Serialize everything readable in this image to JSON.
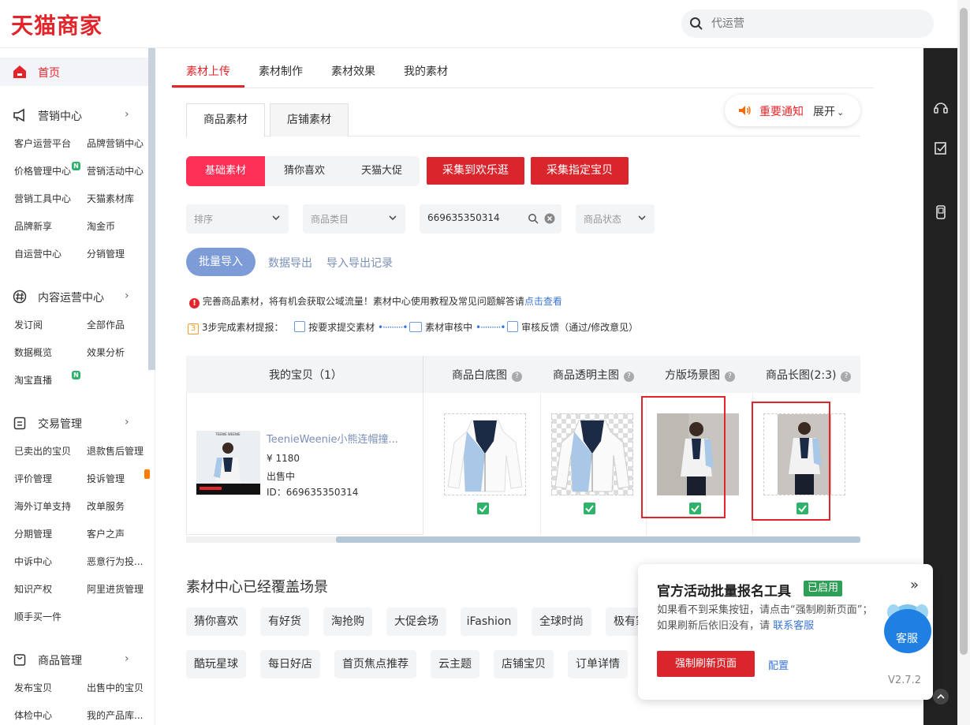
{
  "header": {
    "logo": "天猫商家",
    "search_placeholder": "代运营"
  },
  "sidebar": {
    "home": "首页",
    "sections": [
      {
        "title": "营销中心",
        "items": [
          "客户运营平台",
          "品牌营销中心",
          "价格管理中心",
          "营销活动中心",
          "营销工具中心",
          "天猫素材库",
          "品牌新享",
          "淘金币",
          "自运营中心",
          "分销管理"
        ]
      },
      {
        "title": "内容运营中心",
        "items": [
          "发订阅",
          "全部作品",
          "数据概览",
          "效果分析",
          "淘宝直播"
        ]
      },
      {
        "title": "交易管理",
        "items": [
          "已卖出的宝贝",
          "退款售后管理",
          "评价管理",
          "投诉管理",
          "海外订单支持",
          "改单服务",
          "分期管理",
          "客户之声",
          "中诉中心",
          "恶意行为投...",
          "知识产权",
          "阿里进货管理",
          "顺手买一件"
        ]
      },
      {
        "title": "商品管理",
        "items": [
          "发布宝贝",
          "出售中的宝贝",
          "体检中心",
          "我的产品库..."
        ]
      }
    ],
    "badge_n": "N"
  },
  "main": {
    "top_tabs": [
      "素材上传",
      "素材制作",
      "素材效果",
      "我的素材"
    ],
    "sub_tabs": [
      "商品素材",
      "店铺素材"
    ],
    "notice": {
      "label": "重要通知",
      "expand": "展开"
    },
    "segments": [
      "基础素材",
      "猜你喜欢",
      "天猫大促"
    ],
    "collect_buttons": [
      "采集到欢乐逛",
      "采集指定宝贝"
    ],
    "filters": {
      "sort": "排序",
      "category": "商品类目",
      "search_value": "669635350314",
      "status": "商品状态"
    },
    "batch_import": "批量导入",
    "data_export": "数据导出",
    "import_export_log": "导入导出记录",
    "tip": {
      "text": "完善商品素材，将有机会获取公域流量！素材中心使用教程及常见问题解答请",
      "link": "点击查看"
    },
    "steps": {
      "num": "3",
      "intro": "3步完成素材提报：",
      "s1": "按要求提交素材",
      "s2": "素材审核中",
      "s3": "审核反馈（通过/修改意见）"
    },
    "table": {
      "col_my": "我的宝贝（1）",
      "cols": [
        "商品白底图",
        "商品透明主图",
        "方版场景图",
        "商品长图(2:3)"
      ],
      "q": "?",
      "product": {
        "title": "TeenieWeenie小熊连帽撞...",
        "price": "¥ 1180",
        "status": "出售中",
        "id": "ID：669635350314"
      }
    },
    "coverage_title": "素材中心已经覆盖场景",
    "tags_row1": [
      "猜你喜欢",
      "有好货",
      "淘抢购",
      "大促会场",
      "iFashion",
      "全球时尚",
      "极有家"
    ],
    "tags_row2": [
      "酷玩星球",
      "每日好店",
      "首页焦点推荐",
      "云主题",
      "店铺宝贝",
      "订单详情"
    ]
  },
  "panel": {
    "title": "官方活动批量报名工具",
    "enabled": "已启用",
    "close": "»",
    "line1": "如果看不到采集按钮，请点击“强制刷新页面”；",
    "line2a": "如果刷新后依旧没有，请",
    "line2b": "联系客服",
    "force_refresh": "强制刷新页面",
    "config": "配置",
    "version": "V2.7.2"
  },
  "kefu": "客服",
  "colors": {
    "brand": "#e4242b",
    "accent_pink": "#ff2f55",
    "link": "#7a8fb8",
    "green": "#2fb36b"
  }
}
